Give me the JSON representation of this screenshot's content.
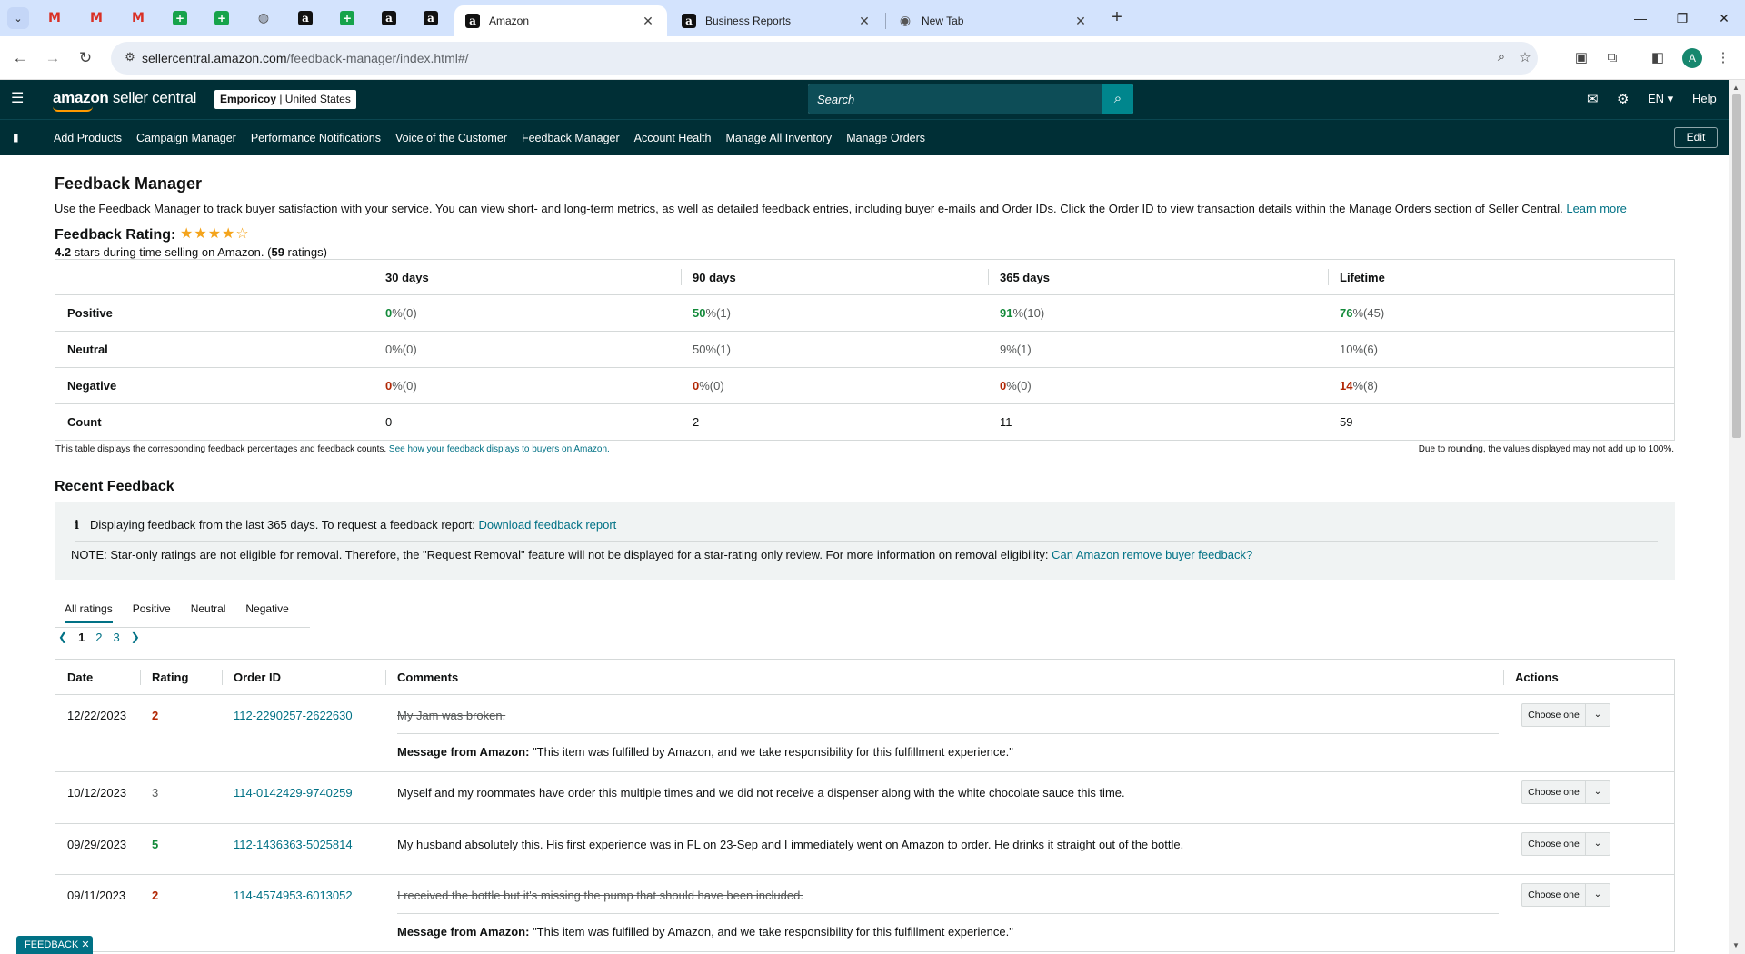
{
  "browser": {
    "tabs": [
      {
        "label": "Amazon",
        "active": true
      },
      {
        "label": "Business Reports",
        "active": false
      },
      {
        "label": "New Tab",
        "active": false
      }
    ],
    "url": "sellercentral.amazon.com/feedback-manager/index.html#/",
    "url_host": "sellercentral.amazon.com",
    "url_path": "/feedback-manager/index.html#/",
    "profile_initial": "A",
    "ext_badge": "Off"
  },
  "header": {
    "logo_bold": "amazon",
    "logo_rest": " seller central",
    "store_name": "Emporicoy",
    "store_region": " | United States",
    "search_placeholder": "Search",
    "language": "EN",
    "help": "Help"
  },
  "nav": {
    "items": [
      "Add Products",
      "Campaign Manager",
      "Performance Notifications",
      "Voice of the Customer",
      "Feedback Manager",
      "Account Health",
      "Manage All Inventory",
      "Manage Orders"
    ],
    "edit": "Edit"
  },
  "page": {
    "title": "Feedback Manager",
    "description": "Use the Feedback Manager to track buyer satisfaction with your service. You can view short- and long-term metrics, as well as detailed feedback entries, including buyer e-mails and Order IDs. Click the Order ID to view transaction details within the Manage Orders section of Seller Central.",
    "learn_more": "Learn more",
    "rating_title": "Feedback Rating:",
    "stars_value": 4.2,
    "rating_stars": "4.2",
    "rating_mid": " stars during time selling on Amazon. (",
    "rating_count": "59",
    "rating_tail": " ratings)"
  },
  "metrics": {
    "columns": [
      "",
      "30 days",
      "90 days",
      "365 days",
      "Lifetime"
    ],
    "rows": {
      "positive": {
        "label": "Positive",
        "values": [
          [
            "0",
            " %(0)"
          ],
          [
            "50",
            " %(1)"
          ],
          [
            "91",
            " %(10)"
          ],
          [
            "76",
            " %(45)"
          ]
        ]
      },
      "neutral": {
        "label": "Neutral",
        "values": [
          [
            "0",
            " %(0)"
          ],
          [
            "50",
            " %(1)"
          ],
          [
            "9",
            " %(1)"
          ],
          [
            "10",
            " %(6)"
          ]
        ]
      },
      "negative": {
        "label": "Negative",
        "values": [
          [
            "0",
            " %(0)"
          ],
          [
            "0",
            " %(0)"
          ],
          [
            "0",
            " %(0)"
          ],
          [
            "14",
            " %(8)"
          ]
        ]
      },
      "count": {
        "label": "Count",
        "values": [
          "0",
          "2",
          "11",
          "59"
        ]
      }
    },
    "note": "This table displays the corresponding feedback percentages and feedback counts.",
    "note_link": "See how your feedback displays to buyers on Amazon.",
    "note_right": "Due to rounding, the values displayed may not add up to 100%."
  },
  "recent": {
    "title": "Recent Feedback",
    "info_text": "Displaying feedback from the last 365 days. To request a feedback report:",
    "info_link": "Download feedback report",
    "note_text": "NOTE: Star-only ratings are not eligible for removal. Therefore, the \"Request Removal\" feature will not be displayed for a star-rating only review. For more information on removal eligibility:",
    "note_link": "Can Amazon remove buyer feedback?",
    "tabs": [
      "All ratings",
      "Positive",
      "Neutral",
      "Negative"
    ],
    "pages": [
      "1",
      "2",
      "3"
    ],
    "columns": [
      "Date",
      "Rating",
      "Order ID",
      "Comments",
      "Actions"
    ],
    "action_label": "Choose one",
    "message_prefix": "Message from Amazon:",
    "rows": [
      {
        "date": "12/22/2023",
        "rating": "2",
        "order": "112-2290257-2622630",
        "comment": "My Jam was broken.",
        "message": "\"This item was fulfilled by Amazon, and we take responsibility for this fulfillment experience.\""
      },
      {
        "date": "10/12/2023",
        "rating": "3",
        "order": "114-0142429-9740259",
        "comment": "Myself and my roommates have order this multiple times and we did not receive a dispenser along with the white chocolate sauce this time."
      },
      {
        "date": "09/29/2023",
        "rating": "5",
        "order": "112-1436363-5025814",
        "comment": "My husband absolutely this. His first experience was in FL on 23-Sep and I immediately went on Amazon to order. He drinks it straight out of the bottle."
      },
      {
        "date": "09/11/2023",
        "rating": "2",
        "order": "114-4574953-6013052",
        "comment": "I received the bottle but it's missing the pump that should have been included.",
        "message": "\"This item was fulfilled by Amazon, and we take responsibility for this fulfillment experience.\""
      }
    ]
  },
  "feedback_tab": "FEEDBACK"
}
